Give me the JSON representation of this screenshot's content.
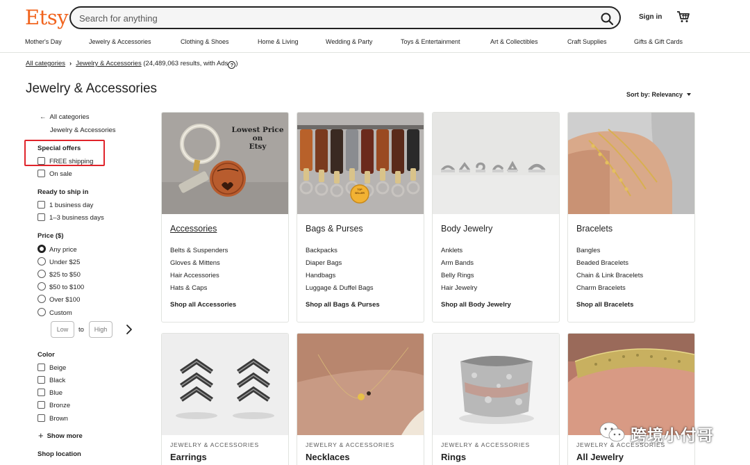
{
  "header": {
    "logo": "Etsy",
    "search_placeholder": "Search for anything",
    "signin": "Sign in",
    "nav": [
      "Mother's Day",
      "Jewelry & Accessories",
      "Clothing & Shoes",
      "Home & Living",
      "Wedding & Party",
      "Toys & Entertainment",
      "Art & Collectibles",
      "Craft Supplies",
      "Gifts & Gift Cards"
    ]
  },
  "breadcrumb": {
    "root": "All categories",
    "current": "Jewelry & Accessories",
    "results": "(24,489,063 results, with Ads",
    "results_end": ")"
  },
  "page": {
    "title": "Jewelry & Accessories",
    "sort": "Sort by: Relevancy"
  },
  "sidebar": {
    "back": "All categories",
    "current": "Jewelry & Accessories",
    "special_offers": {
      "heading": "Special offers",
      "options": [
        "FREE shipping",
        "On sale"
      ]
    },
    "ready_to_ship": {
      "heading": "Ready to ship in",
      "options": [
        "1 business day",
        "1–3 business days"
      ]
    },
    "price": {
      "heading": "Price ($)",
      "options": [
        "Any price",
        "Under $25",
        "$25 to $50",
        "$50 to $100",
        "Over $100",
        "Custom"
      ],
      "selected": "Any price",
      "low_placeholder": "Low",
      "high_placeholder": "High",
      "to": "to"
    },
    "color": {
      "heading": "Color",
      "options": [
        "Beige",
        "Black",
        "Blue",
        "Bronze",
        "Brown"
      ],
      "show_more": "Show more"
    },
    "shop_location": "Shop location"
  },
  "cards_row1": [
    {
      "title": "Accessories",
      "items": [
        "Belts & Suspenders",
        "Gloves & Mittens",
        "Hair Accessories",
        "Hats & Caps"
      ],
      "shop": "Shop all Accessories"
    },
    {
      "title": "Bags & Purses",
      "items": [
        "Backpacks",
        "Diaper Bags",
        "Handbags",
        "Luggage & Duffel Bags"
      ],
      "shop": "Shop all Bags & Purses"
    },
    {
      "title": "Body Jewelry",
      "items": [
        "Anklets",
        "Arm Bands",
        "Belly Rings",
        "Hair Jewelry"
      ],
      "shop": "Shop all Body Jewelry"
    },
    {
      "title": "Bracelets",
      "items": [
        "Bangles",
        "Beaded Bracelets",
        "Chain & Link Bracelets",
        "Charm Bracelets"
      ],
      "shop": "Shop all Bracelets"
    }
  ],
  "cards_row2": [
    {
      "kicker": "JEWELRY & ACCESSORIES",
      "title": "Earrings"
    },
    {
      "kicker": "JEWELRY & ACCESSORIES",
      "title": "Necklaces"
    },
    {
      "kicker": "JEWELRY & ACCESSORIES",
      "title": "Rings"
    },
    {
      "kicker": "JEWELRY & ACCESSORIES",
      "title": "All Jewelry"
    }
  ],
  "image_text": {
    "keychain": [
      "Lowest Price",
      "on",
      "Etsy"
    ],
    "bags_badge": [
      "TOP",
      "SELLER"
    ]
  },
  "watermark": "跨境小付哥",
  "colors": {
    "brand": "#f1641e",
    "highlight": "#e0232a",
    "text": "#222222"
  }
}
